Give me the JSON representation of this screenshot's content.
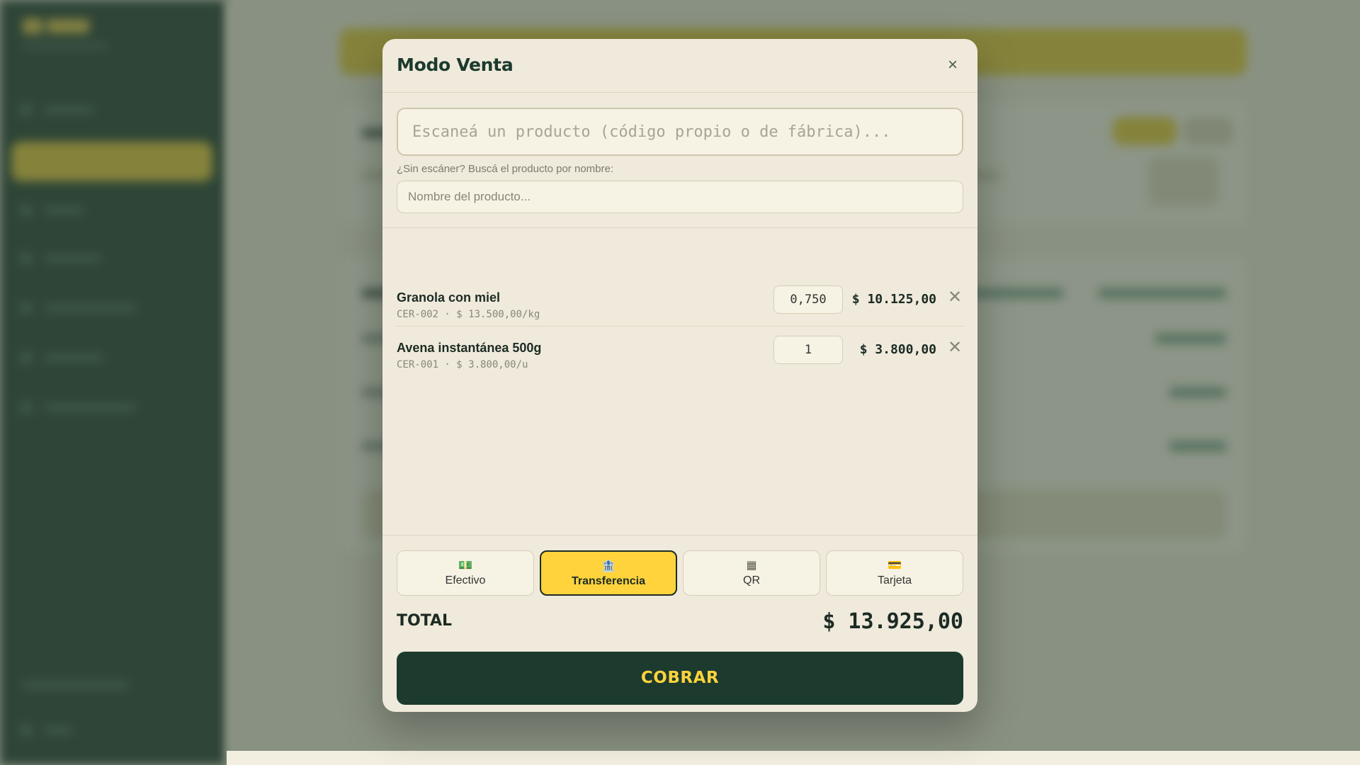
{
  "modal": {
    "title": "Modo Venta",
    "close_label": "×",
    "scan_placeholder": "Escaneá un producto (código propio o de fábrica)...",
    "hint": "¿Sin escáner? Buscá el producto por nombre:",
    "name_placeholder": "Nombre del producto...",
    "items": [
      {
        "name": "Granola con miel",
        "meta": "CER-002 · $ 13.500,00/kg",
        "qty": "0,750",
        "price": "$ 10.125,00",
        "remove": "✕"
      },
      {
        "name": "Avena instantánea 500g",
        "meta": "CER-001 · $ 3.800,00/u",
        "qty": "1",
        "price": "$ 3.800,00",
        "remove": "✕"
      }
    ],
    "payment_methods": [
      {
        "label": "Efectivo",
        "icon": "💵"
      },
      {
        "label": "Transferencia",
        "icon": "🏦"
      },
      {
        "label": "QR",
        "icon": "▦"
      },
      {
        "label": "Tarjeta",
        "icon": "💳"
      }
    ],
    "selected_payment": "Transferencia",
    "total_label": "TOTAL",
    "total_value": "$ 13.925,00",
    "cobrar_label": "COBRAR"
  },
  "colors": {
    "sidebar": "#1c3a2e",
    "accent_yellow": "#fed33c",
    "modal_bg": "#efeadb"
  }
}
